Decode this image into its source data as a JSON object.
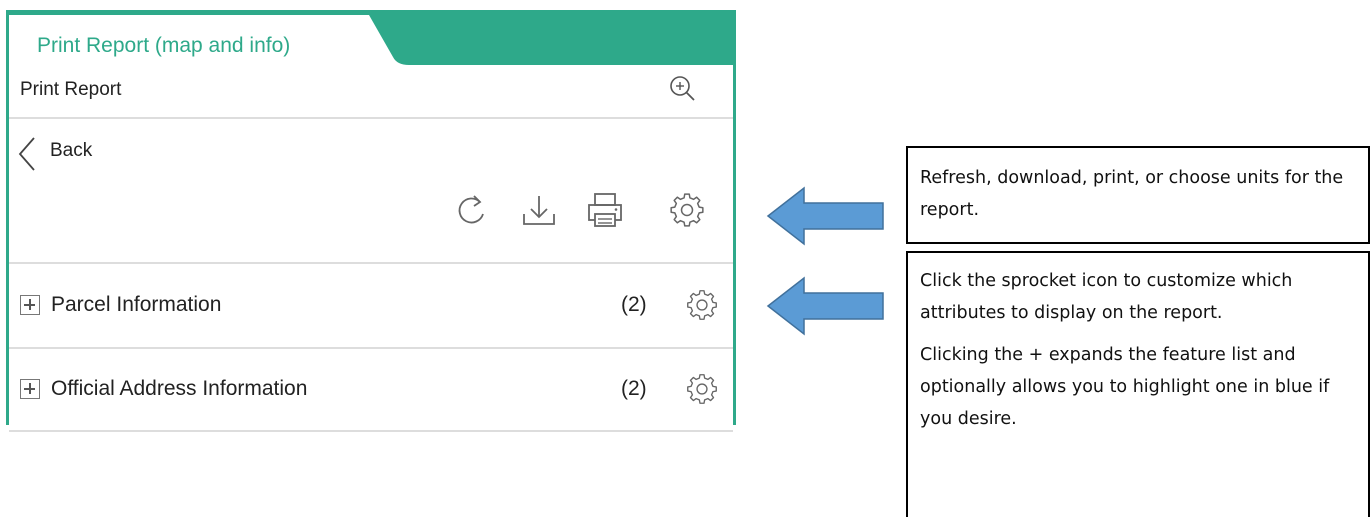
{
  "panel": {
    "tab_label": "Print Report (map and info)",
    "title": "Print Report",
    "back_label": "Back",
    "toolbar_icons": [
      "refresh-icon",
      "download-icon",
      "print-icon",
      "settings-icon"
    ],
    "rows": [
      {
        "label": "Parcel Information",
        "count": "(2)"
      },
      {
        "label": "Official Address Information",
        "count": "(2)"
      }
    ],
    "accent_color": "#2ea98a"
  },
  "callouts": {
    "top": {
      "text": "Refresh, download, print, or choose units for the report."
    },
    "bottom": {
      "paragraph1": "Click the sprocket icon to customize which attributes to display on the report.",
      "paragraph2": "Clicking the + expands the feature list and optionally allows you to highlight one in blue if you desire."
    }
  },
  "arrow_color": "#5b9bd5"
}
